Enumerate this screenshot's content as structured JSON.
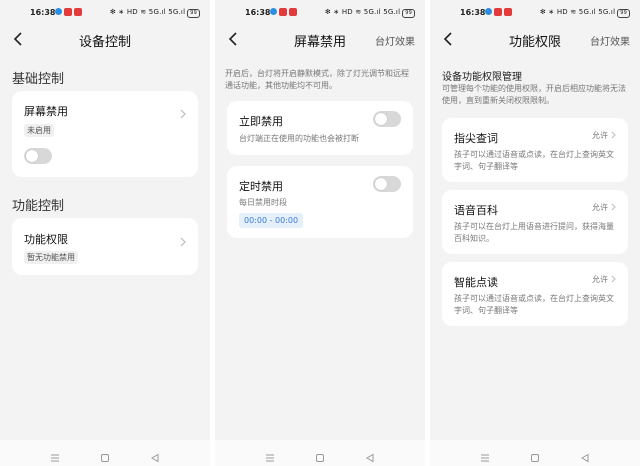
{
  "status": {
    "time": "16:38",
    "sys": "✻ ∗ HD ≋ 5G.ıl 5G.ıl",
    "battery": "99"
  },
  "screen1": {
    "title": "设备控制",
    "section_basic": "基础控制",
    "screen_disable_label": "屏幕禁用",
    "screen_disable_tag": "未启用",
    "section_function": "功能控制",
    "function_permission_label": "功能权限",
    "function_permission_tag": "暂无功能禁用"
  },
  "screen2": {
    "title": "屏幕禁用",
    "right_link": "台灯效果",
    "intro": "开启后，台灯将开启静默模式，除了灯光调节和远程通话功能，其他功能均不可用。",
    "instant_label": "立即禁用",
    "instant_desc": "台灯端正在使用的功能也会被打断",
    "scheduled_label": "定时禁用",
    "scheduled_desc": "每日禁用时段",
    "scheduled_time": "00:00 - 00:00"
  },
  "screen3": {
    "title": "功能权限",
    "right_link": "台灯效果",
    "heading": "设备功能权限管理",
    "intro": "可管理每个功能的使用权限，开启后相应功能将无法使用，直到重新关闭权限限制。",
    "items": [
      {
        "name": "指尖查词",
        "status": "允许",
        "desc_line1": "孩子可以通过语音或点读，在台灯上查询英文",
        "desc_line2": "字词、句子翻译等"
      },
      {
        "name": "语音百科",
        "status": "允许",
        "desc_line1": "孩子可以在台灯上用语音进行提问，获得海量",
        "desc_line2": "百科知识。"
      },
      {
        "name": "智能点读",
        "status": "允许",
        "desc_line1": "孩子可以通过语音或点读，在台灯上查询英文",
        "desc_line2": "字词、句子翻译等"
      }
    ]
  },
  "icons": {
    "back": "back-arrow-icon",
    "chevron": "chevron-right-icon",
    "nav_menu": "menu-icon",
    "nav_home": "home-icon",
    "nav_back": "triangle-back-icon"
  },
  "colors": {
    "accent": "#3a7bd5",
    "background": "#f3f3f3",
    "card": "#ffffff",
    "toggle_off": "#d8d8d8"
  }
}
